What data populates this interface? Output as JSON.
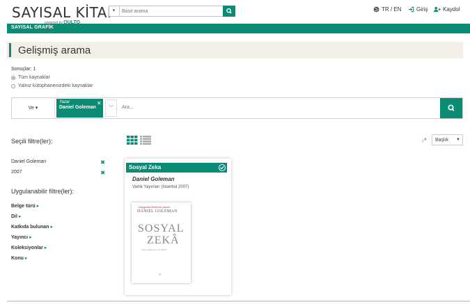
{
  "header": {
    "logo": "SAYISAL KİTAP",
    "logo_sub": "powered by",
    "logo_brand": "QULTO",
    "search_placeholder": "Basit arama",
    "lang": "TR / EN",
    "login": "Giriş",
    "register": "Kaydol"
  },
  "teal_bar": {
    "label": "SAYISAL GRAFİK"
  },
  "page_title": "Gelişmiş arama",
  "results": {
    "count_label": "Sonuçlar: 1",
    "scope_all": "Tüm kaynaklar",
    "scope_library": "Yalnız kütüphanenizdeki kaynaklar"
  },
  "advanced": {
    "operator": "Ve",
    "chip_field": "Yazar",
    "chip_value": "Daniel Goleman",
    "input_placeholder": "Ara..."
  },
  "sidebar": {
    "selected_title": "Seçili filtre(ler):",
    "selected": [
      {
        "label": "Daniel Goleman"
      },
      {
        "label": "2007"
      }
    ],
    "applicable_title": "Uygulanabilir filtre(ler):",
    "facets": [
      {
        "label": "Belge türü"
      },
      {
        "label": "Dil"
      },
      {
        "label": "Katkıda bulunan"
      },
      {
        "label": "Yayıncı"
      },
      {
        "label": "Koleksiyonlar"
      },
      {
        "label": "Konu"
      }
    ]
  },
  "sort": {
    "selected": "Başlık"
  },
  "card": {
    "title": "Sosyal Zeka",
    "author": "Daniel Goleman",
    "publisher": "Varlık Yayınları (İstanbul 2007)",
    "cover": {
      "top_line": "Duygusal Zekâ'nın yazarı",
      "author": "DANIEL GOLEMAN",
      "title_line1": "SOSYAL",
      "title_line2": "ZEKÂ",
      "subtitle": "İnsan İlişkilerinin Yeni Bilimi"
    }
  },
  "colors": {
    "accent": "#0b8a74",
    "title_band": "#f3efe7"
  }
}
